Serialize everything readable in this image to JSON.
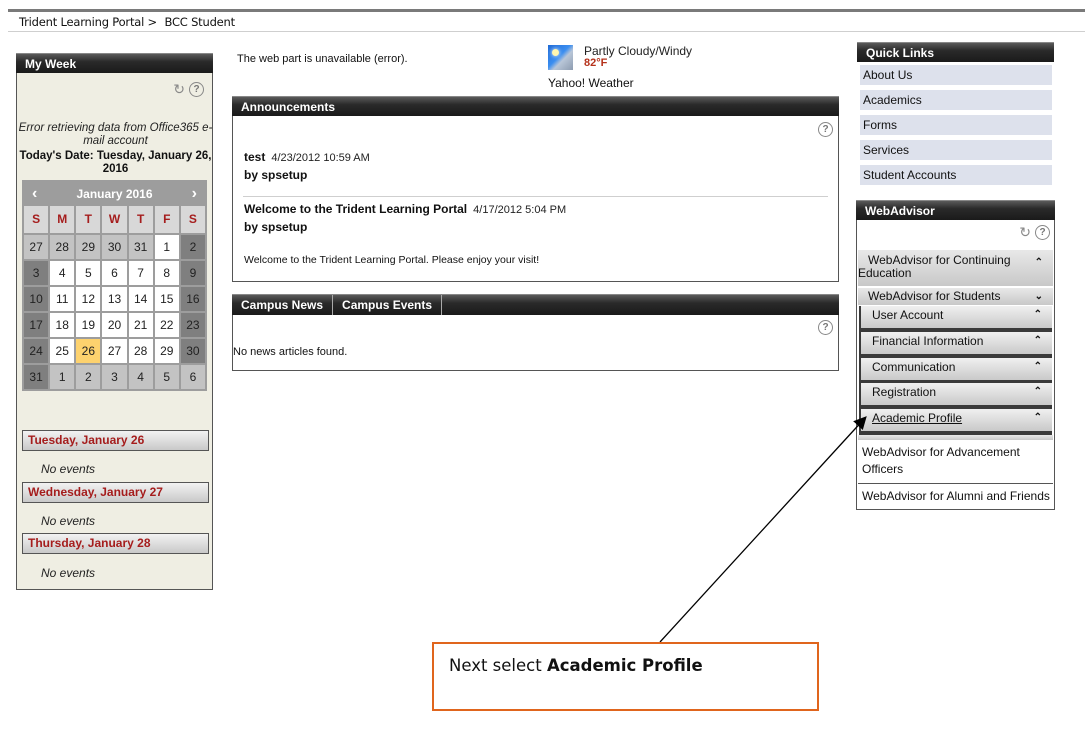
{
  "breadcrumb": {
    "items": [
      "Trident Learning Portal >",
      "BCC Student"
    ]
  },
  "my_week": {
    "title": "My Week",
    "error_text": "Error retrieving data from Office365 e-mail account",
    "today_label": "Today's Date:   Tuesday, January 26, 2016",
    "calendar": {
      "month_label": "January 2016",
      "prev": "‹",
      "next": "›",
      "weekdays": [
        "S",
        "M",
        "T",
        "W",
        "T",
        "F",
        "S"
      ],
      "weeks": [
        [
          {
            "d": "27",
            "t": "other"
          },
          {
            "d": "28",
            "t": "other"
          },
          {
            "d": "29",
            "t": "other"
          },
          {
            "d": "30",
            "t": "other"
          },
          {
            "d": "31",
            "t": "other"
          },
          {
            "d": "1",
            "t": "day"
          },
          {
            "d": "2",
            "t": "weekend"
          }
        ],
        [
          {
            "d": "3",
            "t": "weekend"
          },
          {
            "d": "4",
            "t": "day"
          },
          {
            "d": "5",
            "t": "day"
          },
          {
            "d": "6",
            "t": "day"
          },
          {
            "d": "7",
            "t": "day"
          },
          {
            "d": "8",
            "t": "day"
          },
          {
            "d": "9",
            "t": "weekend"
          }
        ],
        [
          {
            "d": "10",
            "t": "weekend"
          },
          {
            "d": "11",
            "t": "day"
          },
          {
            "d": "12",
            "t": "day"
          },
          {
            "d": "13",
            "t": "day"
          },
          {
            "d": "14",
            "t": "day"
          },
          {
            "d": "15",
            "t": "day"
          },
          {
            "d": "16",
            "t": "weekend"
          }
        ],
        [
          {
            "d": "17",
            "t": "weekend"
          },
          {
            "d": "18",
            "t": "day"
          },
          {
            "d": "19",
            "t": "day"
          },
          {
            "d": "20",
            "t": "day"
          },
          {
            "d": "21",
            "t": "day"
          },
          {
            "d": "22",
            "t": "day"
          },
          {
            "d": "23",
            "t": "weekend"
          }
        ],
        [
          {
            "d": "24",
            "t": "weekend"
          },
          {
            "d": "25",
            "t": "day"
          },
          {
            "d": "26",
            "t": "today"
          },
          {
            "d": "27",
            "t": "day"
          },
          {
            "d": "28",
            "t": "day"
          },
          {
            "d": "29",
            "t": "day"
          },
          {
            "d": "30",
            "t": "weekend"
          }
        ],
        [
          {
            "d": "31",
            "t": "weekend"
          },
          {
            "d": "1",
            "t": "other"
          },
          {
            "d": "2",
            "t": "other"
          },
          {
            "d": "3",
            "t": "other"
          },
          {
            "d": "4",
            "t": "other"
          },
          {
            "d": "5",
            "t": "other"
          },
          {
            "d": "6",
            "t": "other"
          }
        ]
      ]
    },
    "days": [
      {
        "label": "Tuesday, January 26",
        "events": "No events"
      },
      {
        "label": "Wednesday, January 27",
        "events": "No events"
      },
      {
        "label": "Thursday, January 28",
        "events": "No events"
      }
    ]
  },
  "webpart_error": "The web part is unavailable (error).",
  "weather": {
    "condition": "Partly Cloudy/Windy",
    "temp": "82°F",
    "source": "Yahoo! Weather"
  },
  "announcements": {
    "title": "Announcements",
    "items": [
      {
        "title": "test",
        "date": "4/23/2012 10:59 AM",
        "by": "by spsetup",
        "body": ""
      },
      {
        "title": "Welcome to the Trident Learning Portal",
        "date": "4/17/2012 5:04 PM",
        "by": "by spsetup",
        "body": "Welcome to the Trident Learning Portal.  Please enjoy your visit!"
      }
    ]
  },
  "news": {
    "tabs": [
      "Campus News",
      "Campus Events"
    ],
    "empty": "No news articles found."
  },
  "quick_links": {
    "title": "Quick Links",
    "items": [
      "About Us",
      "Academics",
      "Forms",
      "Services",
      "Student Accounts"
    ]
  },
  "webadvisor": {
    "title": "WebAdvisor",
    "sections": {
      "continuing": "WebAdvisor for Continuing Education",
      "students": "WebAdvisor for Students",
      "subs": [
        "User Account",
        "Financial Information",
        "Communication",
        "Registration",
        "Academic Profile"
      ],
      "advancement": "WebAdvisor for Advancement Officers",
      "alumni": "WebAdvisor for Alumni and Friends"
    }
  },
  "callout": {
    "prefix": "Next select ",
    "bold": "Academic Profile",
    "border_color": "#e0651d"
  },
  "icons": {
    "up": "⌃",
    "down": "⌄",
    "refresh": "🗘",
    "help": "?"
  }
}
